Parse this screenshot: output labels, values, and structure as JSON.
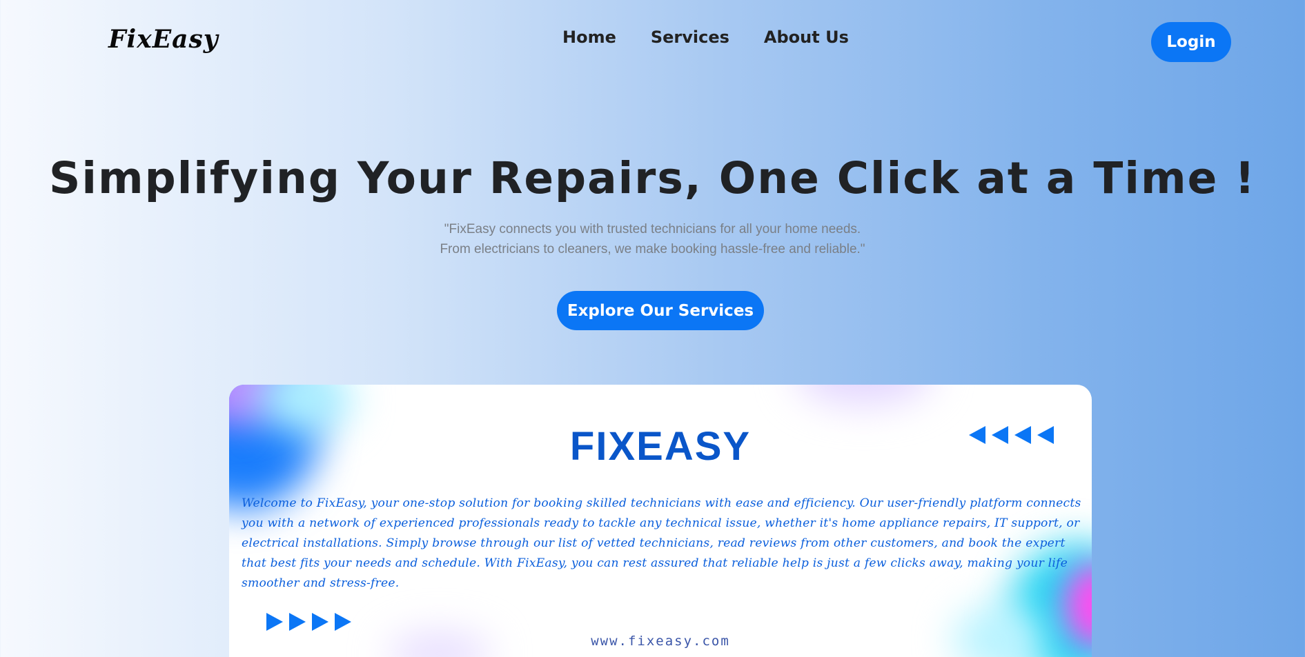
{
  "nav": {
    "logo": "FixEasy",
    "links": [
      "Home",
      "Services",
      "About Us"
    ],
    "login_label": "Login"
  },
  "hero": {
    "title": "Simplifying Your Repairs, One Click at a Time !",
    "subtitle_line1": "\"FixEasy connects you with trusted technicians for all your home needs.",
    "subtitle_line2": "From electricians to cleaners, we make booking hassle-free and reliable.\"",
    "cta_label": "Explore Our Services"
  },
  "card": {
    "title": "FIXEASY",
    "description": "Welcome to FixEasy, your one-stop solution for booking skilled technicians with ease and efficiency. Our user-friendly platform connects you with a network of experienced professionals ready to tackle any technical issue, whether it's home appliance repairs, IT support, or electrical installations. Simply browse through our list of vetted technicians, read reviews from other customers, and book the expert that best fits your needs and schedule. With FixEasy, you can rest assured that reliable help is just a few clicks away, making your life smoother and stress-free.",
    "url": "www.fixeasy.com",
    "decor_left_icon": "triangle-left-icon",
    "decor_right_icon": "triangle-right-icon"
  },
  "colors": {
    "accent": "#0b76f5",
    "card_title": "#0a56c9",
    "card_text": "#0b5fdc"
  }
}
